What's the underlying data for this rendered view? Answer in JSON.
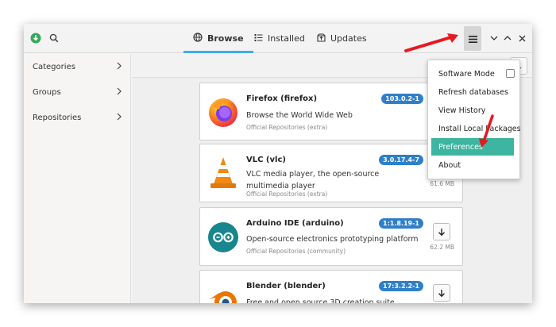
{
  "headerbar": {
    "tabs": [
      {
        "label": "Browse",
        "icon": "globe-icon",
        "active": true
      },
      {
        "label": "Installed",
        "icon": "installed-list-icon",
        "active": false
      },
      {
        "label": "Updates",
        "icon": "updates-icon",
        "active": false
      }
    ],
    "icons": [
      "app-logo-icon",
      "search-icon",
      "hamburger-menu-icon",
      "minimize-icon",
      "maximize-icon",
      "close-icon"
    ],
    "accent_color": "#3daee9"
  },
  "sidebar": {
    "items": [
      {
        "label": "Categories"
      },
      {
        "label": "Groups"
      },
      {
        "label": "Repositories"
      }
    ]
  },
  "packages": [
    {
      "name": "Firefox (firefox)",
      "description": "Browse the World Wide Web",
      "repo": "Official Repositories (extra)",
      "version": "103.0.2-1",
      "size": ""
    },
    {
      "name": "VLC (vlc)",
      "description": "VLC media player, the open-source multimedia player",
      "repo": "Official Repositories (extra)",
      "version": "3.0.17.4-7",
      "size": "61.6 MB"
    },
    {
      "name": "Arduino IDE (arduino)",
      "description": "Open-source electronics prototyping platform",
      "repo": "Official Repositories (community)",
      "version": "1:1.8.19-1",
      "size": "62.2 MB"
    },
    {
      "name": "Blender (blender)",
      "description": "Free and open source 3D creation suite",
      "repo": "",
      "version": "17:3.2.2-1",
      "size": ""
    }
  ],
  "menu": {
    "items": [
      {
        "label": "Software Mode",
        "checkbox": true,
        "checked": false
      },
      {
        "label": "Refresh databases"
      },
      {
        "label": "View History"
      },
      {
        "label": "Install Local Packages"
      },
      {
        "label": "Preferences",
        "highlighted": true
      },
      {
        "label": "About"
      }
    ],
    "highlight_color": "#3db5a0"
  },
  "annotation_color": "#e8191e"
}
